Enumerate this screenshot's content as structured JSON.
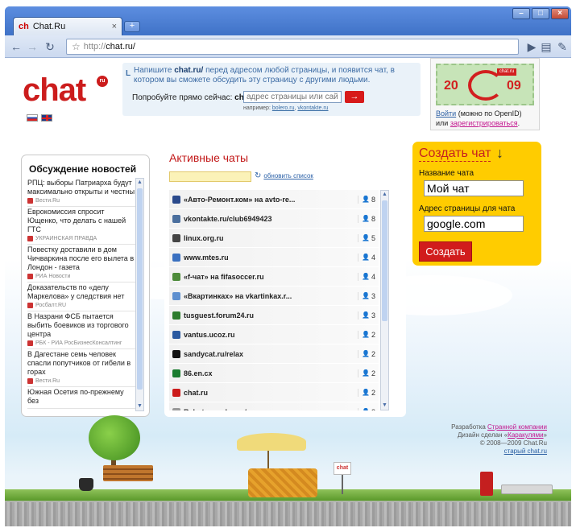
{
  "browser": {
    "tab_title": "Chat.Ru",
    "tab_favicon": "ch",
    "close_glyph": "×",
    "new_tab_glyph": "+",
    "url_prefix": "http://",
    "url": "chat.ru/",
    "window_controls": [
      "–",
      "□",
      "×"
    ]
  },
  "header": {
    "logo_text": "chat",
    "logo_badge": "ru",
    "intro_bullet": "L",
    "intro_prefix": "Напишите ",
    "intro_site": "chat.ru/",
    "intro_text": " перед адресом любой страницы, и появится чат, в котором вы сможете обсудить эту страницу с другими людьми.",
    "try_label": "Попробуйте прямо сейчас:",
    "try_site": "chat.ru/",
    "try_placeholder": "адрес страницы или сайта",
    "go_glyph": "→",
    "example_label": "например:",
    "example_links": [
      "bolero.ru",
      "vkontakte.ru"
    ]
  },
  "banner": {
    "year_left": "20",
    "year_right": "09",
    "tag": "chat.ru",
    "login_link": "Войти",
    "login_note": "(можно по OpenID)",
    "or_text": "или",
    "register_link": "зарегистрироваться",
    "period": "."
  },
  "news": {
    "title": "Обсуждение новостей",
    "items": [
      {
        "title": "РПЦ: выборы Патриарха будут максимально открыты и честны",
        "source": "Вести.Ru"
      },
      {
        "title": "Еврокомиссия спросит Ющенко, что делать с нашей ГТС",
        "source": "УКРАИНСКАЯ ПРАВДА"
      },
      {
        "title": "Повестку доставили в дом Чичваркина после его вылета в Лондон - газета",
        "source": "РИА Новости"
      },
      {
        "title": "Доказательств по «делу Маркелова» у следствия нет",
        "source": "Росбалт.RU"
      },
      {
        "title": "В Назрани ФСБ пытается выбить боевиков из торгового центра",
        "source": "РБК - РИА РосБизнесКонсалтинг"
      },
      {
        "title": "В Дагестане семь человек спасли попутчиков от гибели в горах",
        "source": "Вести.Ru"
      },
      {
        "title": "Южная Осетия по-прежнему без",
        "source": ""
      }
    ]
  },
  "chats": {
    "title": "Активные чаты",
    "refresh_label": "обновить список",
    "rows": [
      {
        "name": "«Авто-Ремонт.ком» на avto-re...",
        "count": "8",
        "color": "#2a4a8c"
      },
      {
        "name": "vkontakte.ru/club6949423",
        "count": "8",
        "color": "#4b6f9e"
      },
      {
        "name": "linux.org.ru",
        "count": "5",
        "color": "#444444"
      },
      {
        "name": "www.mtes.ru",
        "count": "4",
        "color": "#3a70c0"
      },
      {
        "name": "«f-чат» на fifasoccer.ru",
        "count": "4",
        "color": "#4d8b3a"
      },
      {
        "name": "«Вкартинках» на vkartinkax.r...",
        "count": "3",
        "color": "#5f90cf"
      },
      {
        "name": "tusguest.forum24.ru",
        "count": "3",
        "color": "#2d7c2d"
      },
      {
        "name": "vantus.ucoz.ru",
        "count": "2",
        "color": "#2b5aa0"
      },
      {
        "name": "sandycat.ru/relax",
        "count": "2",
        "color": "#111111"
      },
      {
        "name": "86.en.cx",
        "count": "2",
        "color": "#1b7c2f"
      },
      {
        "name": "chat.ru",
        "count": "2",
        "color": "#cc1c1c"
      },
      {
        "name": "Rabota.yandex.ru/s...",
        "count": "2",
        "color": "#999999"
      }
    ]
  },
  "create": {
    "title": "Создать чат",
    "arrow": "↓",
    "name_label": "Название чата",
    "name_value": "Мой чат",
    "url_label": "Адрес страницы для чата",
    "url_value": "google.com",
    "submit_label": "Создать"
  },
  "footer": {
    "dev_prefix": "Разработка ",
    "dev_link": "Странной компании",
    "design_prefix": "Дизайн сделан «",
    "design_link": "Каракулями",
    "design_suffix": "»",
    "copyright": "© 2008—2009 Chat.Ru",
    "old_link": "старый chat.ru"
  },
  "scene": {
    "sign_text": "chat"
  }
}
